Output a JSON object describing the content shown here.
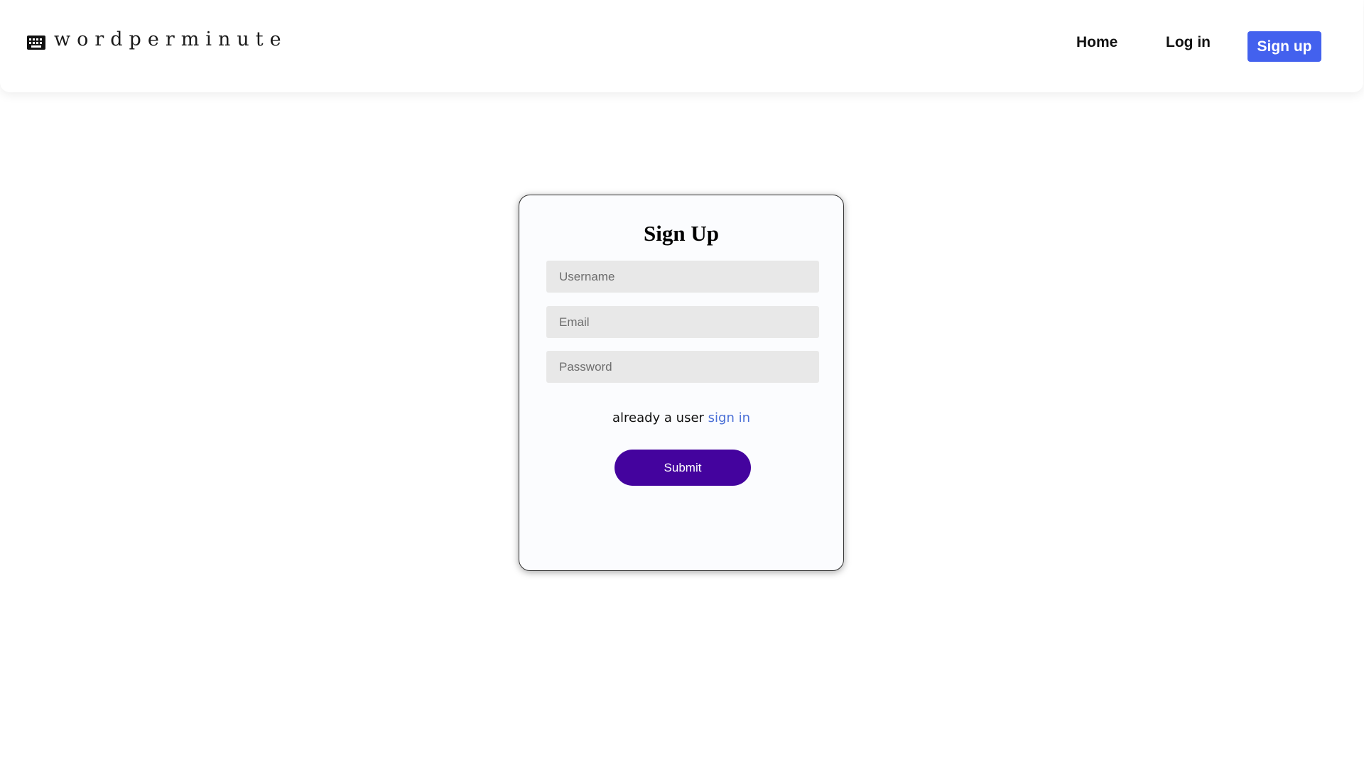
{
  "navbar": {
    "brand": "wordperminute",
    "brand_icon": "keyboard-icon",
    "links": {
      "home": "Home",
      "login": "Log in",
      "signup": "Sign up"
    },
    "signup_color": "#4361ee"
  },
  "form": {
    "title": "Sign Up",
    "username_placeholder": "Username",
    "email_placeholder": "Email",
    "password_placeholder": "Password",
    "switch_text": "already a user",
    "switch_link": "sign in",
    "submit_label": "Submit",
    "submit_color": "#44039e"
  }
}
